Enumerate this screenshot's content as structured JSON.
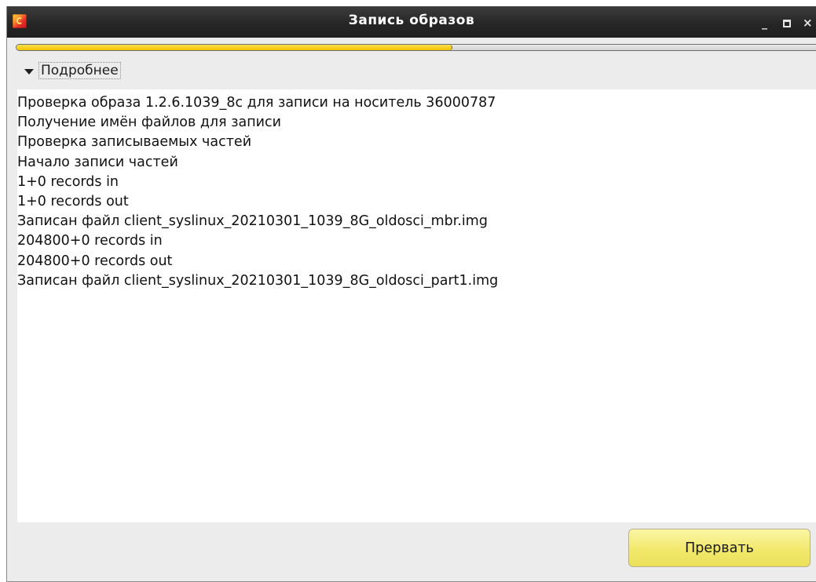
{
  "window": {
    "title": "Запись образов",
    "icon": "app-logo-icon",
    "controls": {
      "minimize": "_",
      "maximize": "maximize-icon",
      "close": "×"
    }
  },
  "progress": {
    "value_percent": 53.5,
    "fill_color": "#f5d21f"
  },
  "details": {
    "expander_label": "Подробнее",
    "expanded": true
  },
  "log": {
    "lines": [
      "Проверка образа 1.2.6.1039_8c для записи на носитель 36000787",
      "Получение имён файлов для записи",
      "Проверка записываемых частей",
      "Начало записи частей",
      "1+0 records in",
      "1+0 records out",
      "Записан файл client_syslinux_20210301_1039_8G_oldosci_mbr.img",
      "204800+0 records in",
      "204800+0 records out",
      "Записан файл client_syslinux_20210301_1039_8G_oldosci_part1.img"
    ]
  },
  "actions": {
    "abort_label": "Прервать",
    "abort_color": "#f3e96b"
  }
}
